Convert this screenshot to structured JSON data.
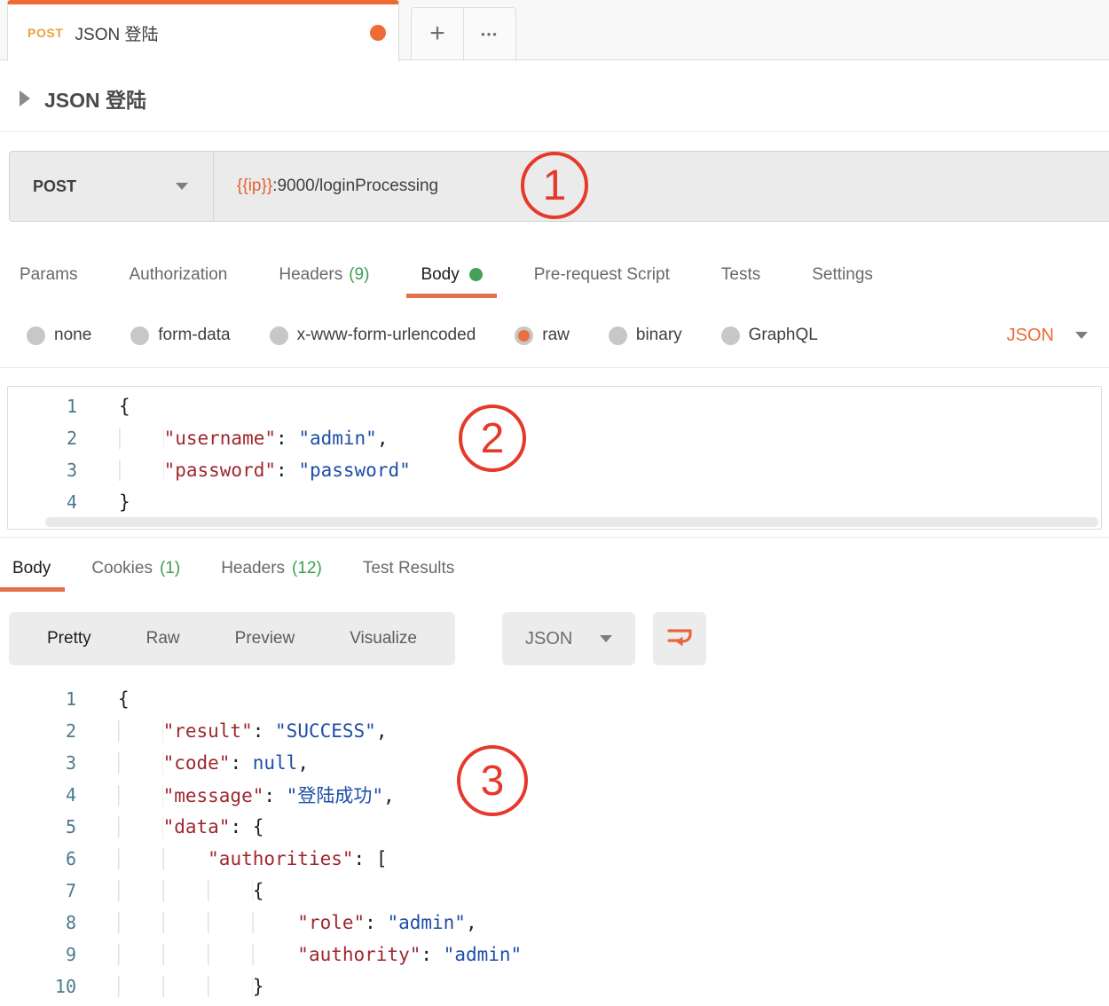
{
  "tab_strip": {
    "active_tab": {
      "method": "POST",
      "title": "JSON 登陆"
    },
    "new_tab_label": "+",
    "more_tabs_label": "•••"
  },
  "doc_header": {
    "title": "JSON 登陆"
  },
  "request_bar": {
    "method": "POST",
    "url_variable": "{{ip}}",
    "url_path": ":9000/loginProcessing"
  },
  "request_tabs": {
    "params": "Params",
    "authorization": "Authorization",
    "headers": "Headers",
    "headers_count": "(9)",
    "body": "Body",
    "prerequest": "Pre-request Script",
    "tests": "Tests",
    "settings": "Settings"
  },
  "body_modes": {
    "none": "none",
    "form_data": "form-data",
    "urlencoded": "x-www-form-urlencoded",
    "raw": "raw",
    "binary": "binary",
    "graphql": "GraphQL",
    "type_selected": "JSON"
  },
  "request_editor": {
    "lines": [
      {
        "num": "1",
        "t0": "{"
      },
      {
        "num": "2",
        "ws": "    ",
        "key": "\"username\"",
        "colon": ": ",
        "val": "\"admin\"",
        "comma": ","
      },
      {
        "num": "3",
        "ws": "    ",
        "key": "\"password\"",
        "colon": ": ",
        "val": "\"password\""
      },
      {
        "num": "4",
        "t0": "}"
      }
    ]
  },
  "response_tabs": {
    "body": "Body",
    "cookies": "Cookies",
    "cookies_count": "(1)",
    "headers": "Headers",
    "headers_count": "(12)",
    "test_results": "Test Results"
  },
  "response_toolbar": {
    "pretty": "Pretty",
    "raw": "Raw",
    "preview": "Preview",
    "visualize": "Visualize",
    "format": "JSON"
  },
  "response_editor": {
    "lines": [
      {
        "num": "1",
        "t0": "{"
      },
      {
        "num": "2",
        "ws": "    ",
        "key": "\"result\"",
        "colon": ": ",
        "val": "\"SUCCESS\"",
        "comma": ","
      },
      {
        "num": "3",
        "ws": "    ",
        "key": "\"code\"",
        "colon": ": ",
        "kw": "null",
        "comma": ","
      },
      {
        "num": "4",
        "ws": "    ",
        "key": "\"message\"",
        "colon": ": ",
        "val": "\"登陆成功\"",
        "comma": ","
      },
      {
        "num": "5",
        "ws": "    ",
        "key": "\"data\"",
        "colon": ": ",
        "open": "{"
      },
      {
        "num": "6",
        "ws": "        ",
        "key": "\"authorities\"",
        "colon": ": ",
        "open": "["
      },
      {
        "num": "7",
        "ws": "            ",
        "t0": "{"
      },
      {
        "num": "8",
        "ws": "                ",
        "key": "\"role\"",
        "colon": ": ",
        "val": "\"admin\"",
        "comma": ","
      },
      {
        "num": "9",
        "ws": "                ",
        "key": "\"authority\"",
        "colon": ": ",
        "val": "\"admin\""
      },
      {
        "num": "10",
        "ws": "            ",
        "t0": "}"
      }
    ]
  },
  "annotations": {
    "a1": "1",
    "a2": "2",
    "a3": "3"
  }
}
